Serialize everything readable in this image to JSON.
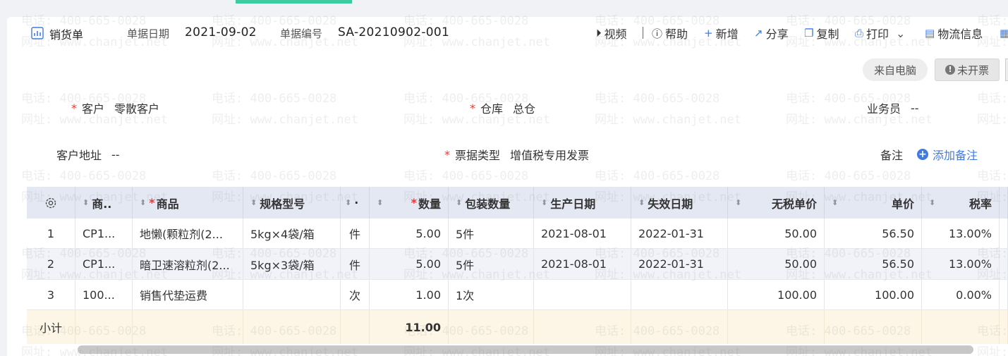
{
  "header": {
    "title": "销货单",
    "date_label": "单据日期",
    "date_value": "2021-09-02",
    "no_label": "单据编号",
    "no_value": "SA-20210902-001"
  },
  "toolbar": {
    "video": "视频",
    "help": "帮助",
    "add": "新增",
    "share": "分享",
    "copy": "复制",
    "print": "打印",
    "logistics": "物流信息"
  },
  "status": {
    "source": "来自电脑",
    "invoice": "未开票"
  },
  "form": {
    "customer_label": "客户",
    "customer_value": "零散客户",
    "warehouse_label": "仓库",
    "warehouse_value": "总仓",
    "salesman_label": "业务员",
    "salesman_value": "--",
    "address_label": "客户地址",
    "address_value": "--",
    "invoice_type_label": "票据类型",
    "invoice_type_value": "增值税专用发票",
    "note_label": "备注",
    "add_note": "添加备注"
  },
  "table": {
    "headers": [
      "商..",
      "商品",
      "规格型号",
      "·",
      "数量",
      "包装数量",
      "生产日期",
      "失效日期",
      "无税单价",
      "单价",
      "税率"
    ],
    "rows": [
      {
        "idx": "1",
        "code": "CP1...",
        "name": "地懒(颗粒剂(2...",
        "spec": "5kg×4袋/箱",
        "unit": "件",
        "qty": "5.00",
        "pack": "5件",
        "mfg": "2021-08-01",
        "exp": "2022-01-31",
        "net_price": "50.00",
        "price": "56.50",
        "tax": "13.00%"
      },
      {
        "idx": "2",
        "code": "CP1...",
        "name": "暗卫速溶粒剂(2...",
        "spec": "5kg×3袋/箱",
        "unit": "件",
        "qty": "5.00",
        "pack": "5件",
        "mfg": "2021-08-01",
        "exp": "2022-01-31",
        "net_price": "50.00",
        "price": "56.50",
        "tax": "13.00%"
      },
      {
        "idx": "3",
        "code": "100...",
        "name": "销售代垫运费",
        "spec": "",
        "unit": "次",
        "qty": "1.00",
        "pack": "1次",
        "mfg": "",
        "exp": "",
        "net_price": "100.00",
        "price": "100.00",
        "tax": "0.00%"
      }
    ],
    "subtotal_label": "小计",
    "subtotal_qty": "11.00"
  },
  "watermark": {
    "phone": "电话: 400-665-0028",
    "site": "网址: www.chanjet.net"
  }
}
